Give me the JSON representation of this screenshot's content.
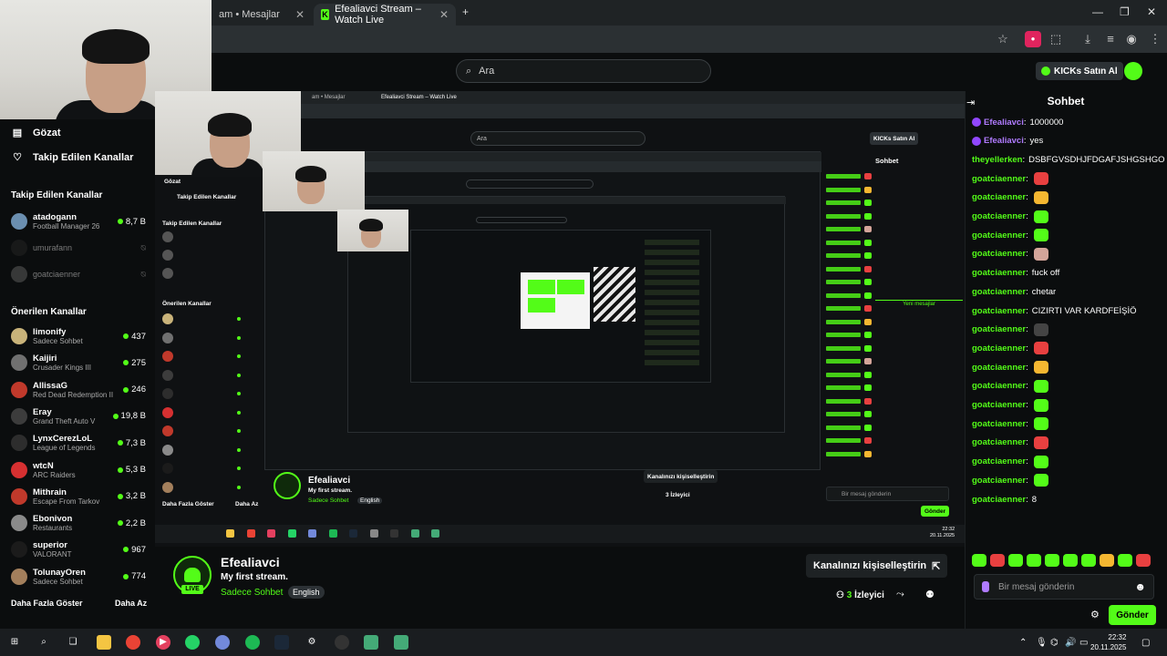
{
  "browser": {
    "tabs": [
      {
        "label": "am • Mesajlar"
      },
      {
        "label": "Efealiavci Stream – Watch Live"
      }
    ],
    "new_tab": "+"
  },
  "header": {
    "search_placeholder": "Ara",
    "kicks_label": "KICKs Satın Al"
  },
  "sidebar": {
    "nav": [
      {
        "label": "Gözat",
        "icon": "compass-icon"
      },
      {
        "label": "Takip Edilen Kanallar",
        "icon": "heart-icon"
      }
    ],
    "followed_header": "Takip Edilen Kanallar",
    "followed": [
      {
        "name": "atadogann",
        "game": "Football Manager 26",
        "viewers": "8,7 B",
        "live": true,
        "color": "#6b8fb0"
      },
      {
        "name": "umurafann",
        "game": "",
        "viewers": "",
        "live": false,
        "color": "#222"
      },
      {
        "name": "goatciaenner",
        "game": "",
        "viewers": "",
        "live": false,
        "color": "#555"
      }
    ],
    "recommended_header": "Önerilen Kanallar",
    "recommended": [
      {
        "name": "limonify",
        "game": "Sadece Sohbet",
        "viewers": "437",
        "color": "#c9b37a"
      },
      {
        "name": "Kaijiri",
        "game": "Crusader Kings III",
        "viewers": "275",
        "color": "#707070"
      },
      {
        "name": "AllissaG",
        "game": "Red Dead Redemption II",
        "viewers": "246",
        "color": "#c0392b"
      },
      {
        "name": "Eray",
        "game": "Grand Theft Auto V",
        "viewers": "19,8 B",
        "color": "#3c3c3c"
      },
      {
        "name": "LynxCerezLoL",
        "game": "League of Legends",
        "viewers": "7,3 B",
        "color": "#2d2d2d"
      },
      {
        "name": "wtcN",
        "game": "ARC Raiders",
        "viewers": "5,3 B",
        "color": "#d63031"
      },
      {
        "name": "Mithrain",
        "game": "Escape From Tarkov",
        "viewers": "3,2 B",
        "color": "#c0392b"
      },
      {
        "name": "Ebonivon",
        "game": "Restaurants",
        "viewers": "2,2 B",
        "color": "#8a8a8a"
      },
      {
        "name": "superior",
        "game": "VALORANT",
        "viewers": "967",
        "color": "#1b1b1b"
      },
      {
        "name": "TolunayOren",
        "game": "Sadece Sohbet",
        "viewers": "774",
        "color": "#a37f5c"
      }
    ],
    "show_more": "Daha Fazla Göster",
    "show_less": "Daha Az"
  },
  "stream": {
    "streamer": "Efealiavci",
    "title": "My first stream.",
    "category": "Sadece Sohbet",
    "language": "English",
    "live_badge": "LIVE",
    "customize_label": "Kanalınızı kişiselleştirin",
    "viewer_count": "3",
    "viewer_label": "İzleyici"
  },
  "chat": {
    "title": "Sohbet",
    "messages": [
      {
        "user": "Efealiavci",
        "text": "1000000",
        "badge": true,
        "emote": ""
      },
      {
        "user": "Efealiavci",
        "text": "yes",
        "badge": true,
        "emote": ""
      },
      {
        "user": "theyellerken",
        "text": "DSBFGVSDHJFDGAFJSHGSHGO",
        "badge": false,
        "emote": ""
      },
      {
        "user": "goatciaenner",
        "text": "",
        "badge": false,
        "emote": "#e84040"
      },
      {
        "user": "goatciaenner",
        "text": "",
        "badge": false,
        "emote": "#f5b731"
      },
      {
        "user": "goatciaenner",
        "text": "",
        "badge": false,
        "emote": "#53fc18"
      },
      {
        "user": "goatciaenner",
        "text": "",
        "badge": false,
        "emote": "#53fc18"
      },
      {
        "user": "goatciaenner",
        "text": "",
        "badge": false,
        "emote": "#d4a59a"
      },
      {
        "user": "goatciaenner",
        "text": "fuck off",
        "badge": false,
        "emote": ""
      },
      {
        "user": "goatciaenner",
        "text": "chetar",
        "badge": false,
        "emote": ""
      },
      {
        "user": "goatciaenner",
        "text": "CIZIRTI VAR KARDFEİŞİÖ",
        "badge": false,
        "emote": ""
      },
      {
        "user": "goatciaenner",
        "text": "",
        "badge": false,
        "emote": "#444"
      },
      {
        "user": "goatciaenner",
        "text": "",
        "badge": false,
        "emote": "#e84040"
      },
      {
        "user": "goatciaenner",
        "text": "",
        "badge": false,
        "emote": "#f5b731"
      },
      {
        "user": "goatciaenner",
        "text": "",
        "badge": false,
        "emote": "#53fc18"
      },
      {
        "user": "goatciaenner",
        "text": "",
        "badge": false,
        "emote": "#53fc18"
      },
      {
        "user": "goatciaenner",
        "text": "",
        "badge": false,
        "emote": "#53fc18"
      },
      {
        "user": "goatciaenner",
        "text": "",
        "badge": false,
        "emote": "#e84040"
      },
      {
        "user": "goatciaenner",
        "text": "",
        "badge": false,
        "emote": "#53fc18"
      },
      {
        "user": "goatciaenner",
        "text": "",
        "badge": false,
        "emote": "#53fc18"
      },
      {
        "user": "goatciaenner",
        "text": "8",
        "badge": false,
        "emote": ""
      }
    ],
    "emote_bar": [
      "#53fc18",
      "#e84040",
      "#53fc18",
      "#53fc18",
      "#53fc18",
      "#53fc18",
      "#53fc18",
      "#f5b731",
      "#53fc18",
      "#e84040"
    ],
    "input_placeholder": "Bir mesaj gönderin",
    "send_label": "Gönder"
  },
  "nested": {
    "tab1": "am • Mesajlar",
    "tab2": "Efealiavci Stream – Watch Live",
    "search": "Ara",
    "kicks": "KICKs Satın Al",
    "browse": "Gözat",
    "followed": "Takip Edilen Kanallar",
    "followed_header": "Takip Edilen Kanallar",
    "recommended_header": "Önerilen Kanallar",
    "chat_title": "Sohbet",
    "new_messages": "Yeni mesajlar",
    "streamer": "Efealiavci",
    "title": "My first stream.",
    "category": "Sadece Sohbet",
    "language": "English",
    "customize": "Kanalınızı kişiselleştirin",
    "viewers": "3 İzleyici",
    "input": "Bir mesaj gönderin",
    "send": "Gönder",
    "show_more": "Daha Fazla Göster",
    "show_less": "Daha Az",
    "clock_time": "22:32",
    "clock_date": "20.11.2025"
  },
  "taskbar": {
    "time": "22:32",
    "date": "20.11.2025"
  },
  "colors": {
    "kick_green": "#53fc18",
    "background": "#0b0d0e",
    "mod_purple": "#b07bff"
  }
}
